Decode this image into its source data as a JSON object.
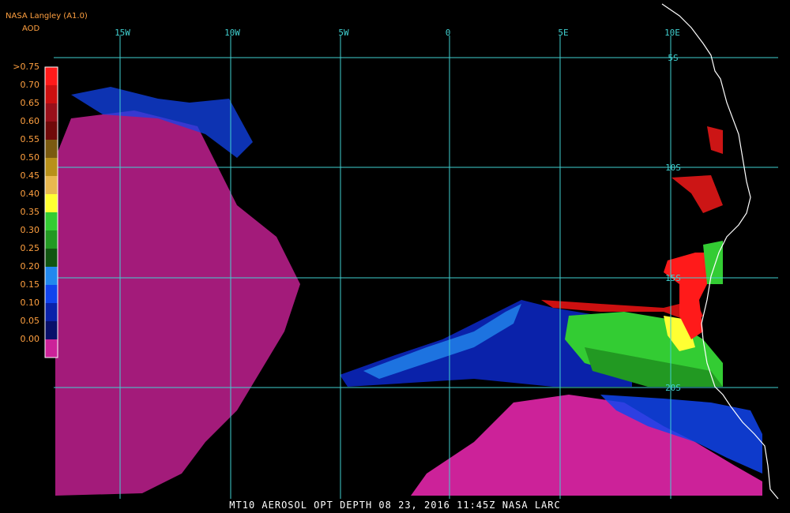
{
  "header": {
    "source": "NASA Langley (A1.0)",
    "product": "AOD"
  },
  "legend": {
    "labels": [
      ">0.75",
      "0.70",
      "0.65",
      "0.60",
      "0.55",
      "0.50",
      "0.45",
      "0.40",
      "0.35",
      "0.30",
      "0.25",
      "0.20",
      "0.15",
      "0.10",
      "0.05",
      "0.00"
    ],
    "colors": [
      "#ff1a1a",
      "#cc1010",
      "#99101a",
      "#700a0a",
      "#7a5a10",
      "#b8901a",
      "#e8b850",
      "#ffff33",
      "#33cc33",
      "#229922",
      "#115511",
      "#2288ee",
      "#1144ee",
      "#0a22aa",
      "#08106a",
      "#cc2299"
    ]
  },
  "longitude_labels": [
    "15W",
    "10W",
    "5W",
    "0",
    "5E",
    "10E"
  ],
  "latitude_labels": [
    "5S",
    "10S",
    "15S",
    "20S"
  ],
  "footer": {
    "text": "MT10  AEROSOL OPT DEPTH   08 23, 2016 11:45Z  NASA LARC"
  }
}
